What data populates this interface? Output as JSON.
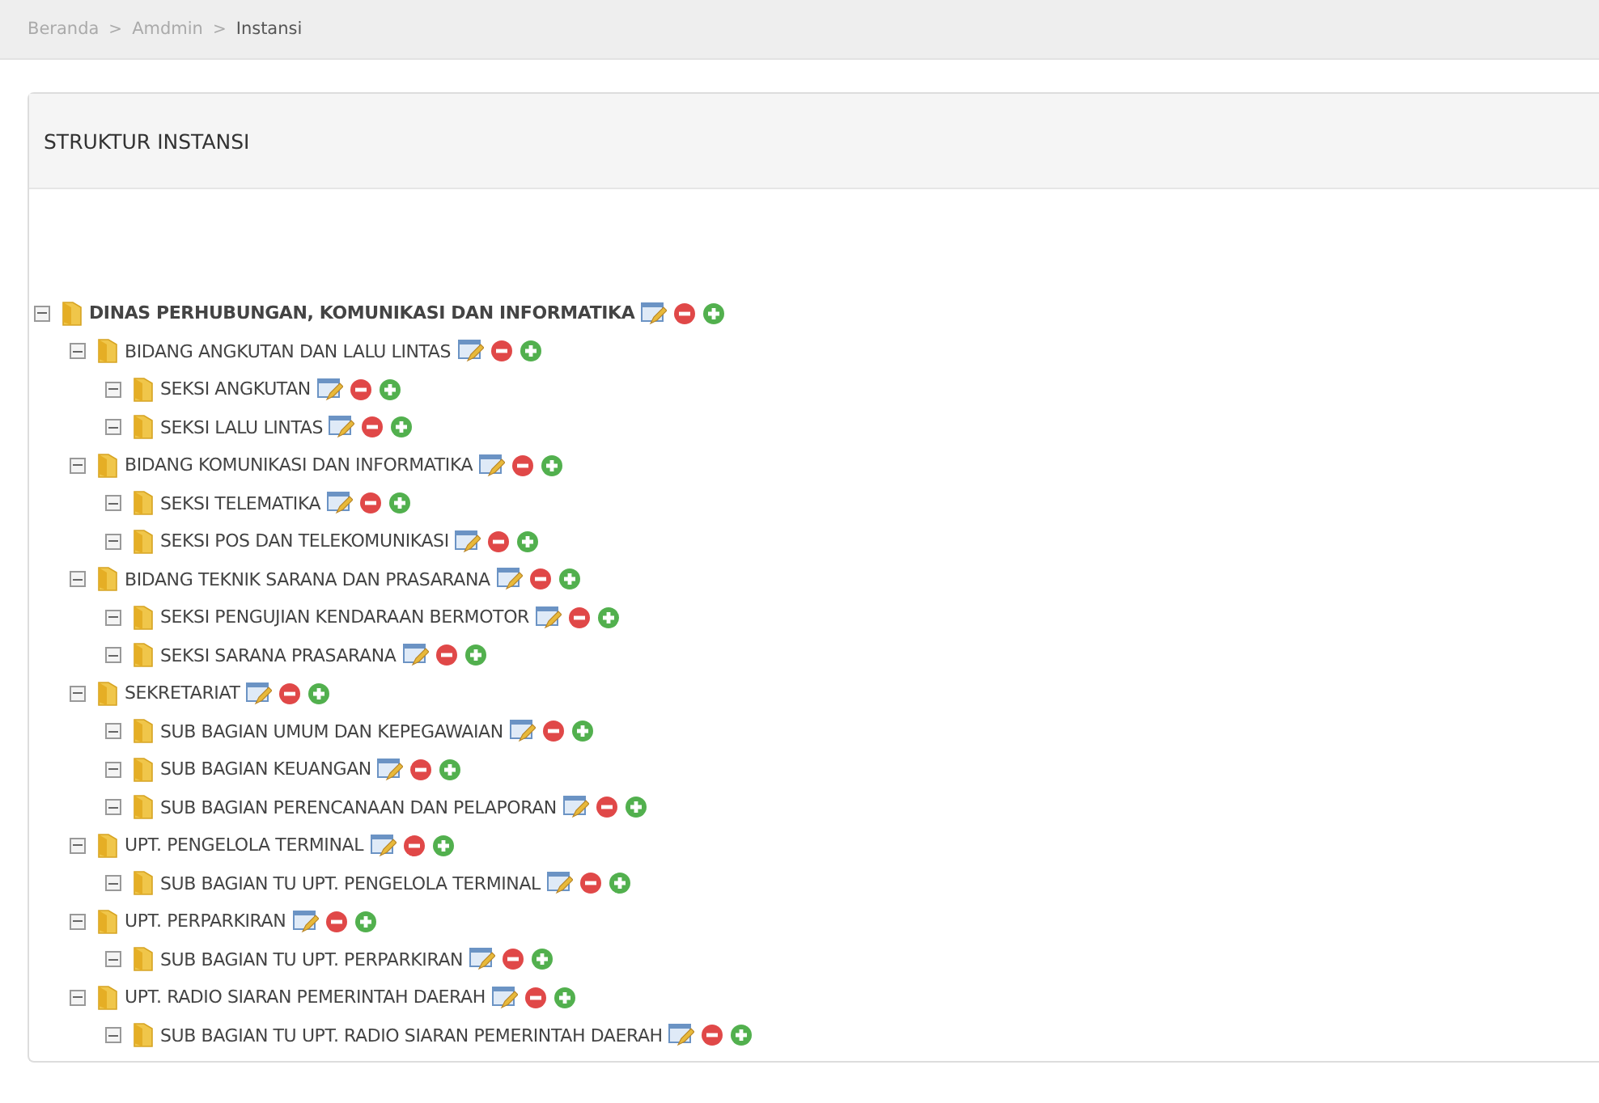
{
  "breadcrumb": [
    {
      "label": "Beranda",
      "current": false
    },
    {
      "label": "Amdmin",
      "current": false
    },
    {
      "label": "Instansi",
      "current": true
    }
  ],
  "breadcrumb_separator": ">",
  "panel": {
    "title": "STRUKTUR INSTANSI"
  },
  "tree": [
    {
      "label": "DINAS PERHUBUNGAN, KOMUNIKASI DAN INFORMATIKA",
      "expanded": true,
      "children": [
        {
          "label": "BIDANG ANGKUTAN DAN LALU LINTAS",
          "expanded": true,
          "children": [
            {
              "label": "SEKSI ANGKUTAN",
              "expanded": true
            },
            {
              "label": "SEKSI LALU LINTAS",
              "expanded": true
            }
          ]
        },
        {
          "label": "BIDANG KOMUNIKASI DAN INFORMATIKA",
          "expanded": true,
          "children": [
            {
              "label": "SEKSI TELEMATIKA",
              "expanded": true
            },
            {
              "label": "SEKSI POS DAN TELEKOMUNIKASI",
              "expanded": true
            }
          ]
        },
        {
          "label": "BIDANG TEKNIK SARANA DAN PRASARANA",
          "expanded": true,
          "children": [
            {
              "label": "SEKSI PENGUJIAN KENDARAAN BERMOTOR",
              "expanded": true
            },
            {
              "label": "SEKSI SARANA PRASARANA",
              "expanded": true
            }
          ]
        },
        {
          "label": "SEKRETARIAT",
          "expanded": true,
          "children": [
            {
              "label": "SUB BAGIAN UMUM DAN KEPEGAWAIAN",
              "expanded": true
            },
            {
              "label": "SUB BAGIAN KEUANGAN",
              "expanded": true
            },
            {
              "label": "SUB BAGIAN PERENCANAAN DAN PELAPORAN",
              "expanded": true
            }
          ]
        },
        {
          "label": "UPT. PENGELOLA TERMINAL",
          "expanded": true,
          "children": [
            {
              "label": "SUB BAGIAN TU UPT. PENGELOLA TERMINAL",
              "expanded": true
            }
          ]
        },
        {
          "label": "UPT. PERPARKIRAN",
          "expanded": true,
          "children": [
            {
              "label": "SUB BAGIAN TU UPT. PERPARKIRAN",
              "expanded": true
            }
          ]
        },
        {
          "label": "UPT. RADIO SIARAN PEMERINTAH DAERAH",
          "expanded": true,
          "children": [
            {
              "label": "SUB BAGIAN TU UPT. RADIO SIARAN PEMERINTAH DAERAH",
              "expanded": true
            }
          ]
        }
      ]
    }
  ]
}
